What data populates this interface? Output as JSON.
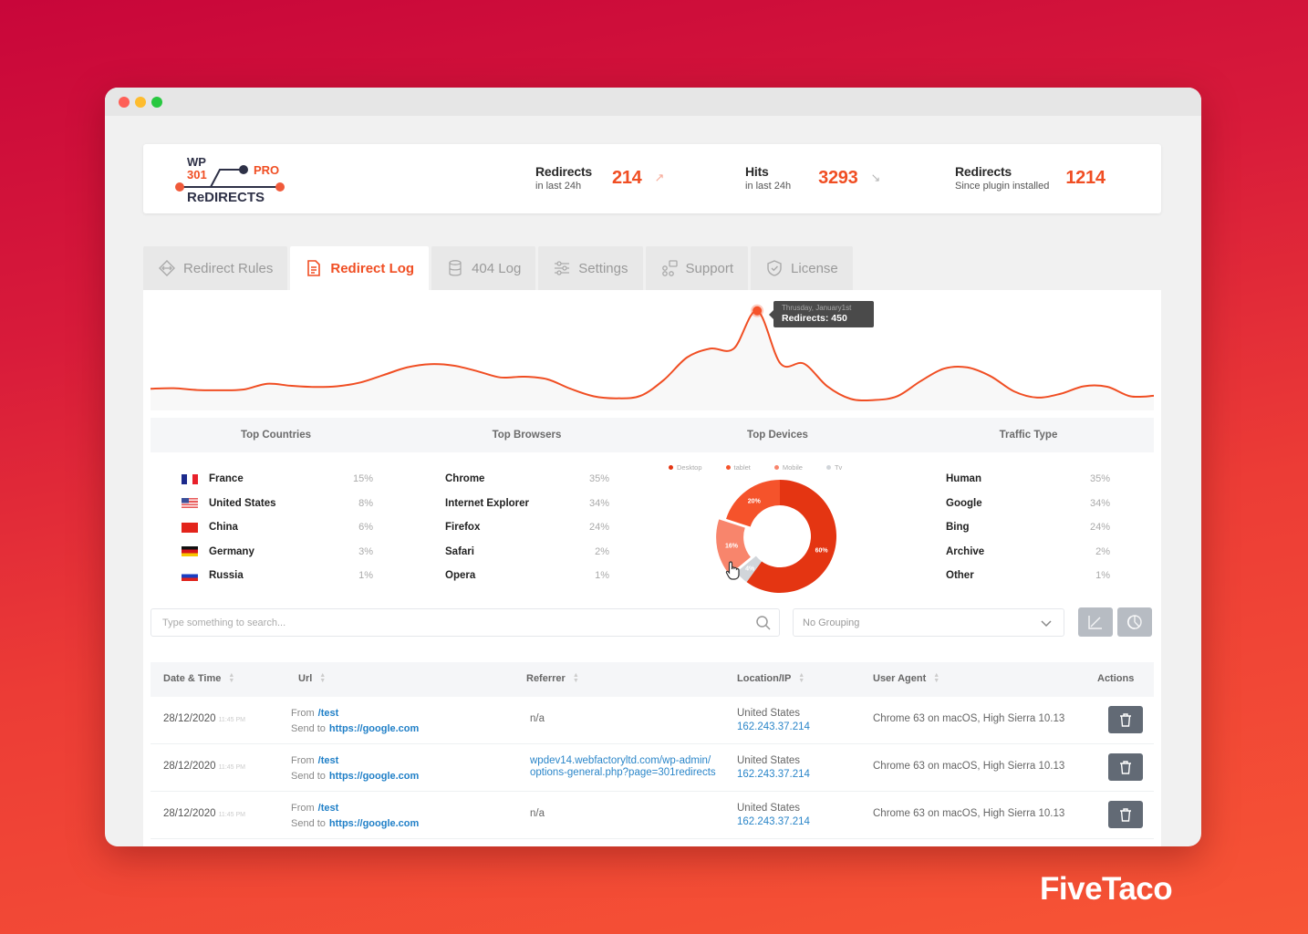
{
  "window": {
    "controls": [
      "close",
      "minimize",
      "maximize"
    ]
  },
  "logo": {
    "line1": "WP",
    "line2": "301",
    "pro": "PRO",
    "name": "ReDIRECTS"
  },
  "stats": [
    {
      "title": "Redirects",
      "subtitle": "in last 24h",
      "value": "214",
      "trend": "up",
      "arrow": "↗"
    },
    {
      "title": "Hits",
      "subtitle": "in last 24h",
      "value": "3293",
      "trend": "down",
      "arrow": "↘"
    },
    {
      "title": "Redirects",
      "subtitle": "Since plugin installed",
      "value": "1214"
    }
  ],
  "tabs": [
    {
      "label": "Redirect Rules",
      "icon": "diamond-arrows-icon",
      "active": false
    },
    {
      "label": "Redirect Log",
      "icon": "document-icon",
      "active": true
    },
    {
      "label": "404 Log",
      "icon": "database-icon",
      "active": false
    },
    {
      "label": "Settings",
      "icon": "sliders-icon",
      "active": false
    },
    {
      "label": "Support",
      "icon": "support-icon",
      "active": false
    },
    {
      "label": "License",
      "icon": "shield-check-icon",
      "active": false
    }
  ],
  "chart_data": {
    "type": "line",
    "title": "",
    "series": [
      {
        "name": "Redirects",
        "values": [
          140,
          142,
          135,
          134,
          137,
          160,
          152,
          147,
          150,
          165,
          195,
          225,
          238,
          232,
          210,
          185,
          188,
          178,
          140,
          110,
          102,
          112,
          175,
          265,
          300,
          300,
          450,
          240,
          240,
          150,
          100,
          95,
          110,
          170,
          220,
          225,
          190,
          130,
          105,
          120,
          150,
          148,
          110,
          112
        ]
      }
    ],
    "tooltip": {
      "date": "Thrusday, January1st",
      "label": "Redirects: 450",
      "value": 450
    },
    "color": "#f04e23"
  },
  "stats_panels": {
    "headers": [
      "Top Countries",
      "Top Browsers",
      "Top Devices",
      "Traffic Type"
    ],
    "countries": [
      {
        "name": "France",
        "pct": "15%",
        "flag": "fr"
      },
      {
        "name": "United States",
        "pct": "8%",
        "flag": "us"
      },
      {
        "name": "China",
        "pct": "6%",
        "flag": "cn"
      },
      {
        "name": "Germany",
        "pct": "3%",
        "flag": "de"
      },
      {
        "name": "Russia",
        "pct": "1%",
        "flag": "ru"
      }
    ],
    "browsers": [
      {
        "name": "Chrome",
        "pct": "35%"
      },
      {
        "name": "Internet Explorer",
        "pct": "34%"
      },
      {
        "name": "Firefox",
        "pct": "24%"
      },
      {
        "name": "Safari",
        "pct": "2%"
      },
      {
        "name": "Opera",
        "pct": "1%"
      }
    ],
    "devices": {
      "legend": [
        {
          "name": "Desktop",
          "color": "#e43512"
        },
        {
          "name": "tablet",
          "color": "#f5532b"
        },
        {
          "name": "Mobile",
          "color": "#f8856c"
        },
        {
          "name": "Tv",
          "color": "#d1d5da"
        }
      ],
      "slices": [
        {
          "name": "Desktop",
          "value": 60,
          "label": "60%",
          "color": "#e43512"
        },
        {
          "name": "Tv",
          "value": 4,
          "label": "4%",
          "color": "#d1d5da"
        },
        {
          "name": "Mobile",
          "value": 16,
          "label": "16%",
          "color": "#f8856c"
        },
        {
          "name": "tablet",
          "value": 20,
          "label": "20%",
          "color": "#f5532b"
        }
      ]
    },
    "traffic": [
      {
        "name": "Human",
        "pct": "35%"
      },
      {
        "name": "Google",
        "pct": "34%"
      },
      {
        "name": "Bing",
        "pct": "24%"
      },
      {
        "name": "Archive",
        "pct": "2%"
      },
      {
        "name": "Other",
        "pct": "1%"
      }
    ]
  },
  "toolbar": {
    "search_placeholder": "Type something to search...",
    "grouping_value": "No Grouping"
  },
  "table": {
    "headers": [
      "Date & Time",
      "Url",
      "Referrer",
      "Location/IP",
      "User Agent",
      "Actions"
    ],
    "rows": [
      {
        "date": "28/12/2020",
        "time": "11:45 PM",
        "from_label": "From",
        "from": "/test",
        "to_label": "Send to",
        "to": "https://google.com",
        "referrer": "n/a",
        "referrer_link": false,
        "location": "United States",
        "ip": "162.243.37.214",
        "agent": "Chrome 63 on macOS, High Sierra 10.13"
      },
      {
        "date": "28/12/2020",
        "time": "11:45 PM",
        "from_label": "From",
        "from": "/test",
        "to_label": "Send to",
        "to": "https://google.com",
        "referrer": "wpdev14.webfactoryltd.com/wp-admin/ options-general.php?page=301redirects",
        "referrer_link": true,
        "location": "United States",
        "ip": "162.243.37.214",
        "agent": "Chrome 63 on macOS, High Sierra 10.13"
      },
      {
        "date": "28/12/2020",
        "time": "11:45 PM",
        "from_label": "From",
        "from": "/test",
        "to_label": "Send to",
        "to": "https://google.com",
        "referrer": "n/a",
        "referrer_link": false,
        "location": "United States",
        "ip": "162.243.37.214",
        "agent": "Chrome 63 on macOS, High Sierra 10.13"
      }
    ]
  },
  "brand": "FiveTaco",
  "colors": {
    "accent": "#f04e23",
    "link": "#2b86c9",
    "delete_button": "#626a75"
  }
}
